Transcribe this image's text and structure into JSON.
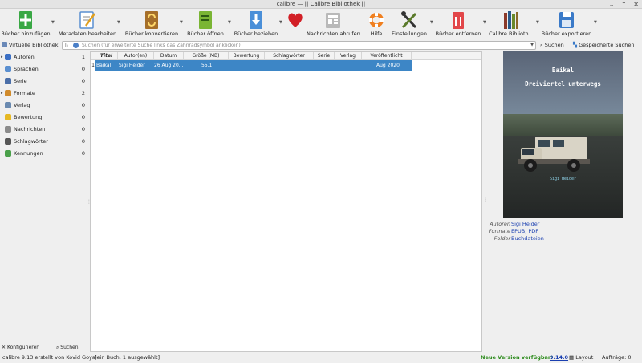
{
  "window": {
    "title": "calibre — || Calibre Bibliothek ||",
    "controls": [
      "⌄",
      "⌃",
      "✕"
    ]
  },
  "toolbar": [
    {
      "id": "add",
      "label": "Bücher hinzufügen",
      "icon": "add-book-icon"
    },
    {
      "id": "edit-meta",
      "label": "Metadaten bearbeiten",
      "icon": "edit-metadata-icon"
    },
    {
      "id": "convert",
      "label": "Bücher konvertieren",
      "icon": "convert-books-icon"
    },
    {
      "id": "view",
      "label": "Bücher öffnen",
      "icon": "view-book-icon"
    },
    {
      "id": "fetch",
      "label": "Bücher beziehen",
      "icon": "download-books-icon"
    },
    {
      "id": "donate",
      "label": "",
      "icon": "heart-icon"
    },
    {
      "id": "news",
      "label": "Nachrichten abrufen",
      "icon": "fetch-news-icon"
    },
    {
      "id": "help",
      "label": "Hilfe",
      "icon": "help-lifebuoy-icon"
    },
    {
      "id": "prefs",
      "label": "Einstellungen",
      "icon": "preferences-tools-icon"
    },
    {
      "id": "remove",
      "label": "Bücher entfernen",
      "icon": "trash-icon"
    },
    {
      "id": "library",
      "label": "Calibre Biblioth...",
      "icon": "library-icon"
    },
    {
      "id": "export",
      "label": "Bücher exportieren",
      "icon": "save-disk-icon"
    }
  ],
  "search": {
    "virtual_library": "Virtuelle Bibliothek",
    "placeholder": "Suchen (für erweiterte Suche links das Zahnradsymbol anklicken)",
    "search_button": "Suchen",
    "saved_searches": "Gespeicherte Suchen"
  },
  "tag_browser": [
    {
      "label": "Autoren",
      "count": "1",
      "icon": "authors-icon",
      "color": "#3b6fc4",
      "expandable": true
    },
    {
      "label": "Sprachen",
      "count": "0",
      "icon": "languages-icon",
      "color": "#5a8fd0",
      "expandable": false
    },
    {
      "label": "Serie",
      "count": "0",
      "icon": "series-icon",
      "color": "#4a6ea8",
      "expandable": false
    },
    {
      "label": "Formate",
      "count": "2",
      "icon": "formats-icon",
      "color": "#d08a2a",
      "expandable": true
    },
    {
      "label": "Verlag",
      "count": "0",
      "icon": "publisher-icon",
      "color": "#6a8ab0",
      "expandable": false
    },
    {
      "label": "Bewertung",
      "count": "0",
      "icon": "rating-star-icon",
      "color": "#e6b823",
      "expandable": false
    },
    {
      "label": "Nachrichten",
      "count": "0",
      "icon": "news-icon",
      "color": "#8a8a8a",
      "expandable": false
    },
    {
      "label": "Schlagwörter",
      "count": "0",
      "icon": "tags-icon",
      "color": "#555555",
      "expandable": false
    },
    {
      "label": "Kennungen",
      "count": "0",
      "icon": "identifiers-icon",
      "color": "#4aa04a",
      "expandable": false
    }
  ],
  "left_bottom": {
    "configure": "Konfigurieren",
    "search": "Suchen"
  },
  "columns": [
    "Titel",
    "Autor(en)",
    "Datum",
    "Größe (MB)",
    "Bewertung",
    "Schlagwörter",
    "Serie",
    "Verlag",
    "Veröffentlicht"
  ],
  "rows": [
    {
      "num": "1",
      "title": "Baikal",
      "author": "Sigi Heider",
      "date": "26 Aug 20...",
      "size": "55.1",
      "rating": "",
      "tags": "",
      "series": "",
      "publisher": "",
      "published": "Aug 2020"
    }
  ],
  "book_details": {
    "cover_title": "Baikal",
    "cover_subtitle": "Dreiviertel unterwegs",
    "cover_author": "Sigi Heider",
    "fields": [
      {
        "key": "Autoren",
        "value": "Sigi Heider"
      },
      {
        "key": "Formate",
        "value": "EPUB, PDF"
      },
      {
        "key": "Folder",
        "value": "Buchdateien"
      }
    ]
  },
  "status": {
    "version_info": "calibre 9.13 erstellt von Kovid Goyal",
    "selection": "[ein Buch, 1 ausgewählt]",
    "update_label": "Neue Version verfügbar:",
    "update_version": "9.14.0",
    "layout": "Layout",
    "jobs": "Aufträge: 0"
  },
  "colors": {
    "selection": "#3d86c6",
    "link": "#1a3fb0",
    "update": "#2a8a1a"
  }
}
